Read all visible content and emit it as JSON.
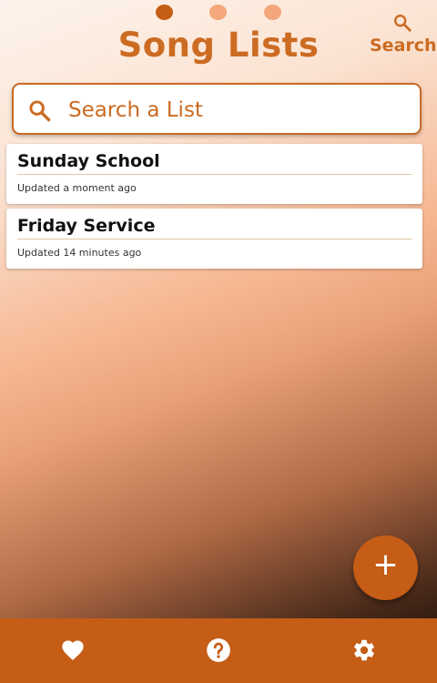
{
  "header": {
    "title": "Song Lists",
    "search_label": "Search",
    "page_indicator": {
      "count": 3,
      "active_index": 0
    }
  },
  "search": {
    "placeholder": "Search a List",
    "value": ""
  },
  "lists": [
    {
      "name": "Sunday School",
      "updated": "Updated a moment ago"
    },
    {
      "name": "Friday Service",
      "updated": "Updated 14 minutes ago"
    }
  ],
  "fab": {
    "icon": "plus-icon",
    "symbol": "+"
  },
  "bottom_nav": [
    {
      "icon": "heart-icon"
    },
    {
      "icon": "help-icon"
    },
    {
      "icon": "gear-icon"
    }
  ],
  "colors": {
    "accent": "#c55d17",
    "accent_light": "#f3a77a",
    "title": "#cc6b22"
  }
}
